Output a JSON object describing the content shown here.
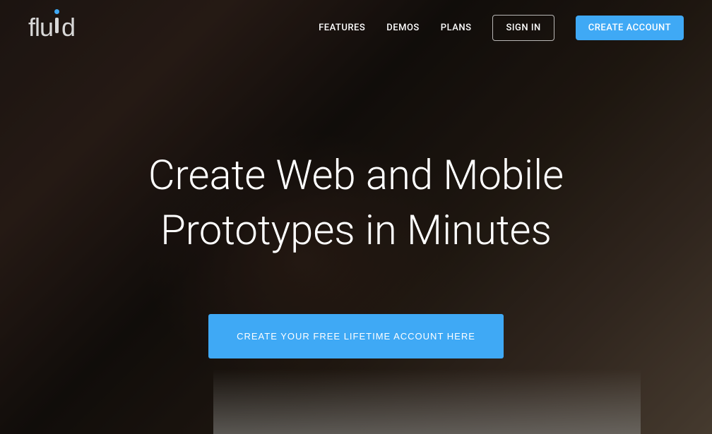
{
  "brand": {
    "name": "fluid"
  },
  "nav": {
    "links": [
      {
        "label": "FEATURES"
      },
      {
        "label": "DEMOS"
      },
      {
        "label": "PLANS"
      }
    ],
    "signin_label": "SIGN IN",
    "create_account_label": "CREATE ACCOUNT"
  },
  "hero": {
    "title": "Create Web and Mobile Prototypes in Minutes",
    "cta_label": "CREATE YOUR FREE LIFETIME ACCOUNT HERE"
  },
  "colors": {
    "primary": "#3fa9f5",
    "text_light": "#ffffff"
  }
}
